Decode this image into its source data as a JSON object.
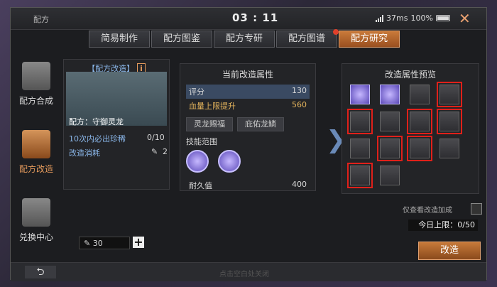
{
  "title": "配方",
  "clock": "03 : 11",
  "status": {
    "ping": "37ms",
    "battery": "100%"
  },
  "tabs": [
    "简易制作",
    "配方图鉴",
    "配方专研",
    "配方图谱",
    "配方研究"
  ],
  "nav": [
    "配方合成",
    "配方改造",
    "兑换中心"
  ],
  "left": {
    "header": "【配方改造】",
    "info": "i",
    "recipe": "配方：守御灵龙",
    "line1_label": "10次内必出珍稀",
    "line1_value": "0/10",
    "line2_label": "改造消耗",
    "line2_value": "2",
    "qty": "30"
  },
  "middle": {
    "title": "当前改造属性",
    "rows": [
      {
        "label": "评分",
        "value": "130"
      },
      {
        "label": "血量上限提升",
        "value": "560"
      }
    ],
    "buttons": [
      "灵龙赐福",
      "庇佑龙鳞"
    ],
    "skill_title": "技能范围",
    "durability_label": "耐久值",
    "durability_value": "400"
  },
  "right": {
    "title": "改造属性预览",
    "checkbox_label": "仅查看改造加成",
    "limit": "今日上限：0/50",
    "cta": "改造"
  },
  "bottom_hint": "点击空白处关闭"
}
